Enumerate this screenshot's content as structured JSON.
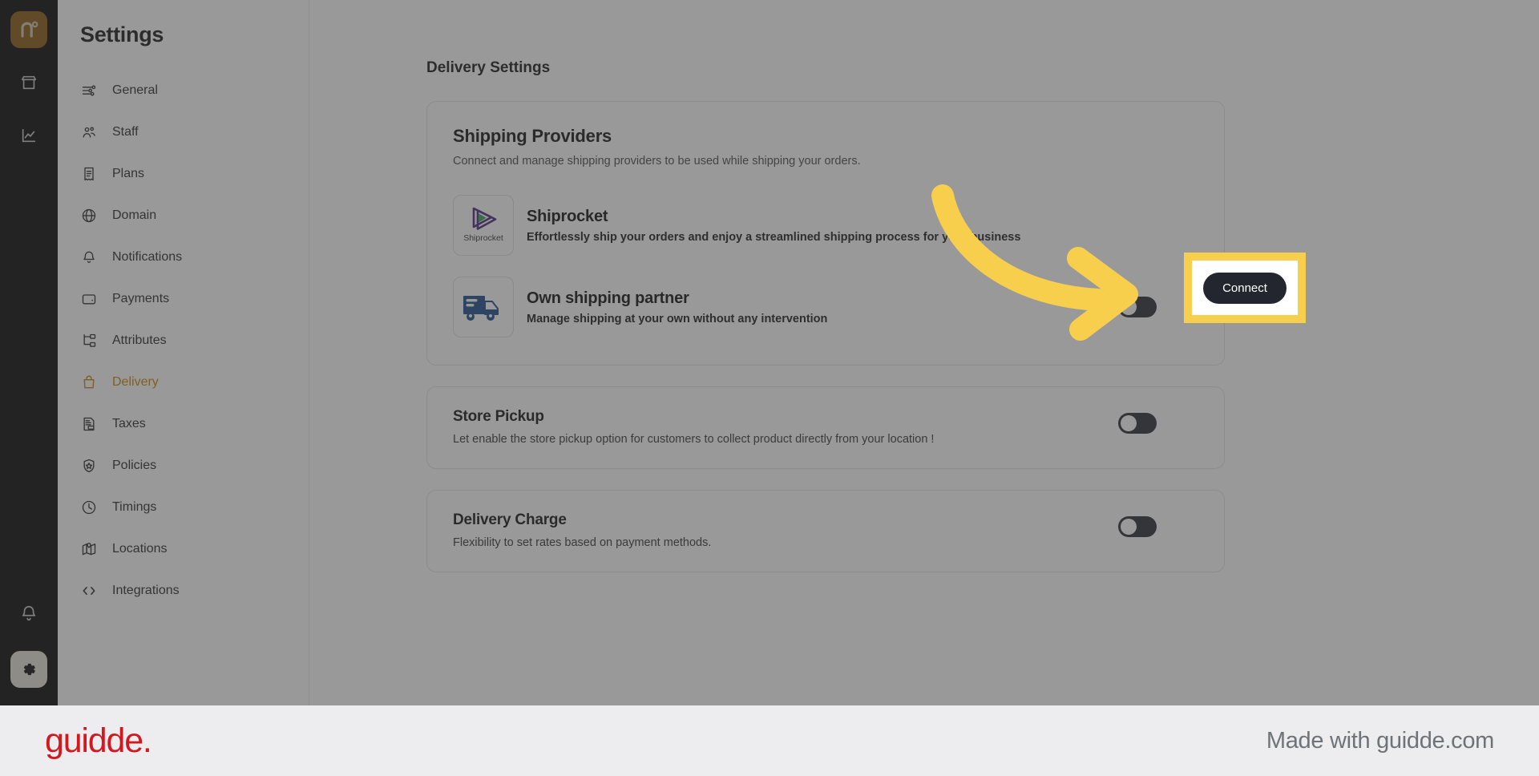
{
  "rail": {
    "logo_text": "n",
    "items": [
      {
        "name": "store-icon",
        "label": "Store"
      },
      {
        "name": "analytics-icon",
        "label": "Analytics"
      }
    ],
    "bottom": [
      {
        "name": "bell-icon",
        "label": "Notifications"
      },
      {
        "name": "gear-icon",
        "label": "Settings"
      }
    ]
  },
  "sidebar": {
    "title": "Settings",
    "active": "Delivery",
    "items": [
      {
        "label": "General",
        "icon": "sliders-icon"
      },
      {
        "label": "Staff",
        "icon": "users-icon"
      },
      {
        "label": "Plans",
        "icon": "receipt-icon"
      },
      {
        "label": "Domain",
        "icon": "globe-icon"
      },
      {
        "label": "Notifications",
        "icon": "bell-icon"
      },
      {
        "label": "Payments",
        "icon": "wallet-icon"
      },
      {
        "label": "Attributes",
        "icon": "tree-icon"
      },
      {
        "label": "Delivery",
        "icon": "bag-icon"
      },
      {
        "label": "Taxes",
        "icon": "tax-document-icon"
      },
      {
        "label": "Policies",
        "icon": "shield-icon"
      },
      {
        "label": "Timings",
        "icon": "clock-icon"
      },
      {
        "label": "Locations",
        "icon": "map-icon"
      },
      {
        "label": "Integrations",
        "icon": "code-icon"
      }
    ]
  },
  "main": {
    "page_title": "Delivery Settings",
    "shipping_providers": {
      "title": "Shipping Providers",
      "subtitle": "Connect and manage shipping providers to be used while shipping your orders.",
      "providers": [
        {
          "name": "Shiprocket",
          "description": "Effortlessly ship your orders and enjoy a streamlined shipping process for your business",
          "logo": "shiprocket-logo",
          "logo_caption": "Shiprocket",
          "action_type": "button",
          "action_label": "Connect",
          "highlighted": true
        },
        {
          "name": "Own shipping partner",
          "description": "Manage shipping at your own without any intervention",
          "logo": "delivery-truck-icon",
          "logo_caption": "",
          "action_type": "toggle",
          "action_label": "",
          "toggle_on": false,
          "highlighted": false
        }
      ]
    },
    "store_pickup": {
      "title": "Store Pickup",
      "subtitle": "Let enable the store pickup option for customers to collect product directly from your location !",
      "toggle_on": false
    },
    "delivery_charge": {
      "title": "Delivery Charge",
      "subtitle": "Flexibility to set rates based on payment methods.",
      "toggle_on": false
    }
  },
  "footer": {
    "logo_text": "guidde.",
    "made_with": "Made with guidde.com"
  },
  "colors": {
    "accent": "#c8860d",
    "highlight": "#f8cf4d",
    "rail_bg": "#0a0a0a",
    "button_bg": "#23262e",
    "brand_red": "#d31920",
    "shiprocket_purple": "#4c2a82",
    "shiprocket_green": "#2fa84f",
    "truck_blue": "#1f4e8c"
  }
}
